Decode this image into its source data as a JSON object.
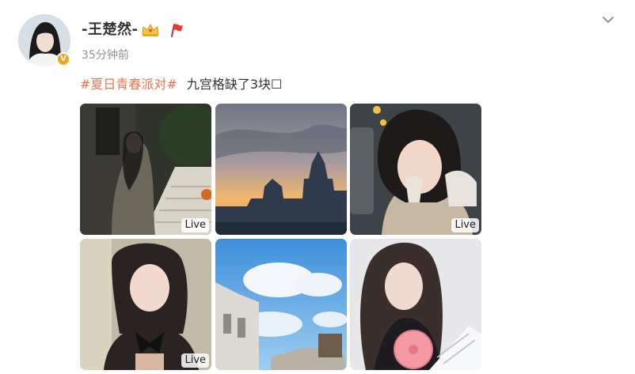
{
  "user": {
    "name": "-王楚然-",
    "verified_badge": "V",
    "time": "35分钟前"
  },
  "post": {
    "hashtag": "#夏日青春派对#",
    "text": "九宫格缺了3块☐"
  },
  "icons": {
    "menu": "chevron-down-icon",
    "crown": "crown-icon",
    "flag": "red-flag-icon"
  },
  "colors": {
    "hashtag": "#eb7350",
    "verified": "#f7a21b",
    "time": "#939393"
  },
  "photos": [
    {
      "description": "woman standing by white stairs at night",
      "live": "Live"
    },
    {
      "description": "sunset sky over domed building",
      "live": ""
    },
    {
      "description": "woman with scarf and mirror",
      "live": "Live"
    },
    {
      "description": "close-up portrait with black bow",
      "live": "Live"
    },
    {
      "description": "blue sky with clouds over old building",
      "live": ""
    },
    {
      "description": "woman holding pink fan reading paper",
      "live": ""
    }
  ]
}
